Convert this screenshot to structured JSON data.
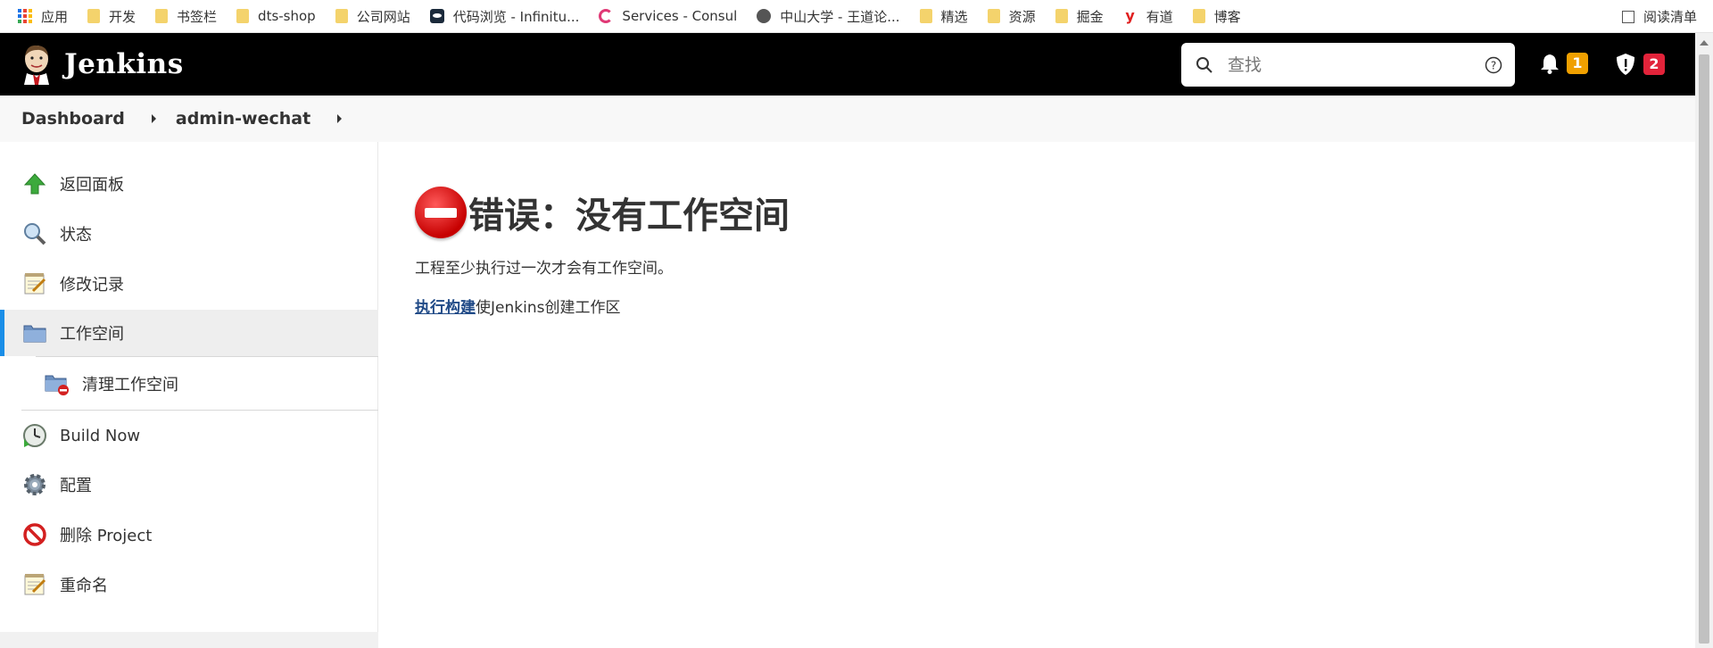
{
  "bookmarks": {
    "items": [
      {
        "label": "应用",
        "icon": "apps-grid-icon"
      },
      {
        "label": "开发",
        "icon": "folder-icon"
      },
      {
        "label": "书签栏",
        "icon": "folder-icon"
      },
      {
        "label": "dts-shop",
        "icon": "folder-icon"
      },
      {
        "label": "公司网站",
        "icon": "folder-icon"
      },
      {
        "label": "代码浏览 - Infinitu...",
        "icon": "site-icon"
      },
      {
        "label": "Services - Consul",
        "icon": "consul-icon"
      },
      {
        "label": "中山大学 - 王道论...",
        "icon": "globe-icon"
      },
      {
        "label": "精选",
        "icon": "folder-icon"
      },
      {
        "label": "资源",
        "icon": "folder-icon"
      },
      {
        "label": "掘金",
        "icon": "folder-icon"
      },
      {
        "label": "有道",
        "icon": "youdao-icon"
      },
      {
        "label": "博客",
        "icon": "folder-icon"
      }
    ],
    "reading_list": "阅读清单"
  },
  "header": {
    "brand": "Jenkins",
    "search_placeholder": "查找",
    "notifications_count": "1",
    "security_count": "2",
    "colors": {
      "bar": "#000000",
      "notif_badge": "#f0a000",
      "security_badge": "#e2233a"
    }
  },
  "breadcrumb": {
    "items": [
      "Dashboard",
      "admin-wechat"
    ]
  },
  "sidebar": {
    "items": [
      {
        "label": "返回面板",
        "icon": "up-arrow-icon"
      },
      {
        "label": "状态",
        "icon": "magnifier-icon"
      },
      {
        "label": "修改记录",
        "icon": "notepad-icon"
      },
      {
        "label": "工作空间",
        "icon": "folder-icon",
        "active": true
      },
      {
        "label": "清理工作空间",
        "icon": "wipe-folder-icon"
      },
      {
        "label": "Build Now",
        "icon": "clock-icon"
      },
      {
        "label": "配置",
        "icon": "gear-icon"
      },
      {
        "label": "删除 Project",
        "icon": "no-entry-icon"
      },
      {
        "label": "重命名",
        "icon": "notepad-icon"
      }
    ]
  },
  "main": {
    "error_title": "错误：没有工作空间",
    "message": "工程至少执行过一次才会有工作空间。",
    "build_link": "执行构建",
    "build_suffix": "使Jenkins创建工作区"
  }
}
